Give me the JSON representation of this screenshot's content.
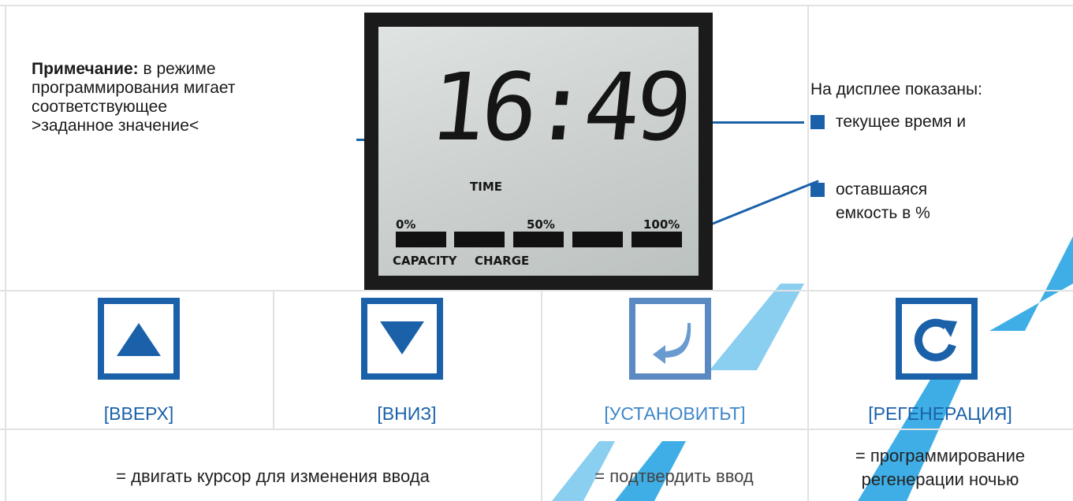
{
  "note": {
    "label": "Примечание:",
    "line1": "в режиме",
    "line2": "программирования мигает",
    "line3": "соответствующее",
    "line4": ">заданное значение<"
  },
  "lcd": {
    "time_value": "16:49",
    "time_label": "TIME",
    "scale": [
      "0%",
      "50%",
      "100%"
    ],
    "capacity_label": "CAPACITY",
    "charge_label": "CHARGE",
    "segments_filled": 5
  },
  "info": {
    "title": "На дисплее показаны:",
    "bullet1": "текущее время и",
    "bullet2_line1": "оставшаяся",
    "bullet2_line2": "емкость в %"
  },
  "buttons": [
    {
      "icon": "arrow-up-icon",
      "caption": "[ВВЕРХ]"
    },
    {
      "icon": "arrow-down-icon",
      "caption": "[ВНИЗ]"
    },
    {
      "icon": "enter-icon",
      "caption": "[УСТАНОВИТЬТ]"
    },
    {
      "icon": "regeneration-icon",
      "caption": "[РЕГЕНЕРАЦИЯ]"
    }
  ],
  "descriptions": {
    "move": "= двигать курсор для изменения ввода",
    "confirm": "= подтвердить ввод",
    "regen_line1": "= программирование",
    "regen_line2": "регенерации ночью"
  },
  "colors": {
    "accent": "#1a61a9",
    "lcd_background": "#c8cdcb",
    "grid": "#e2e2e2"
  }
}
